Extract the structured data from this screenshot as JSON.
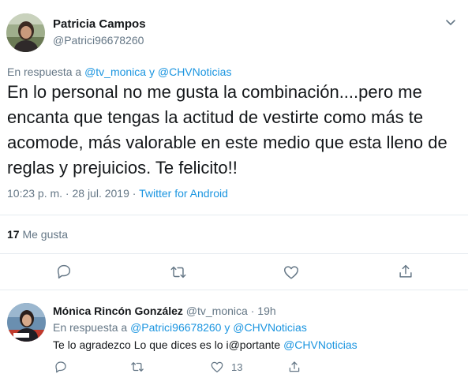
{
  "main_tweet": {
    "author_name": "Patricia Campos",
    "author_handle": "@Patrici96678260",
    "reply_prefix": "En respuesta a",
    "reply_mention_1": "@tv_monica",
    "reply_join": "y",
    "reply_mention_2": "@CHVNoticias",
    "text": "En lo personal no me gusta la combinación....pero me encanta que tengas la actitud de vestirte como más te acomode, más  valorable en este medio que esta lleno de reglas y prejuicios. Te felicito!!",
    "timestamp": "10:23 p. m. · 28 jul. 2019",
    "dot": "·",
    "source": "Twitter for Android",
    "likes_count": "17",
    "likes_label": "Me gusta",
    "actions": [
      "reply-icon",
      "retweet-icon",
      "like-icon",
      "share-icon"
    ]
  },
  "reply_tweet": {
    "author_name": "Mónica Rincón González",
    "author_handle": "@tv_monica",
    "dot": "·",
    "time_ago": "19h",
    "reply_prefix": "En respuesta a",
    "reply_mention_1": "@Patrici96678260",
    "reply_join": "y",
    "reply_mention_2": "@CHVNoticias",
    "text_plain": "Te lo agradezco Lo que dices es lo i@portante",
    "text_mention": "@CHVNoticias",
    "like_count": "13"
  },
  "colors": {
    "link": "#1b95e0",
    "muted": "#657786",
    "text": "#14171a",
    "divider": "#e6ecf0"
  }
}
